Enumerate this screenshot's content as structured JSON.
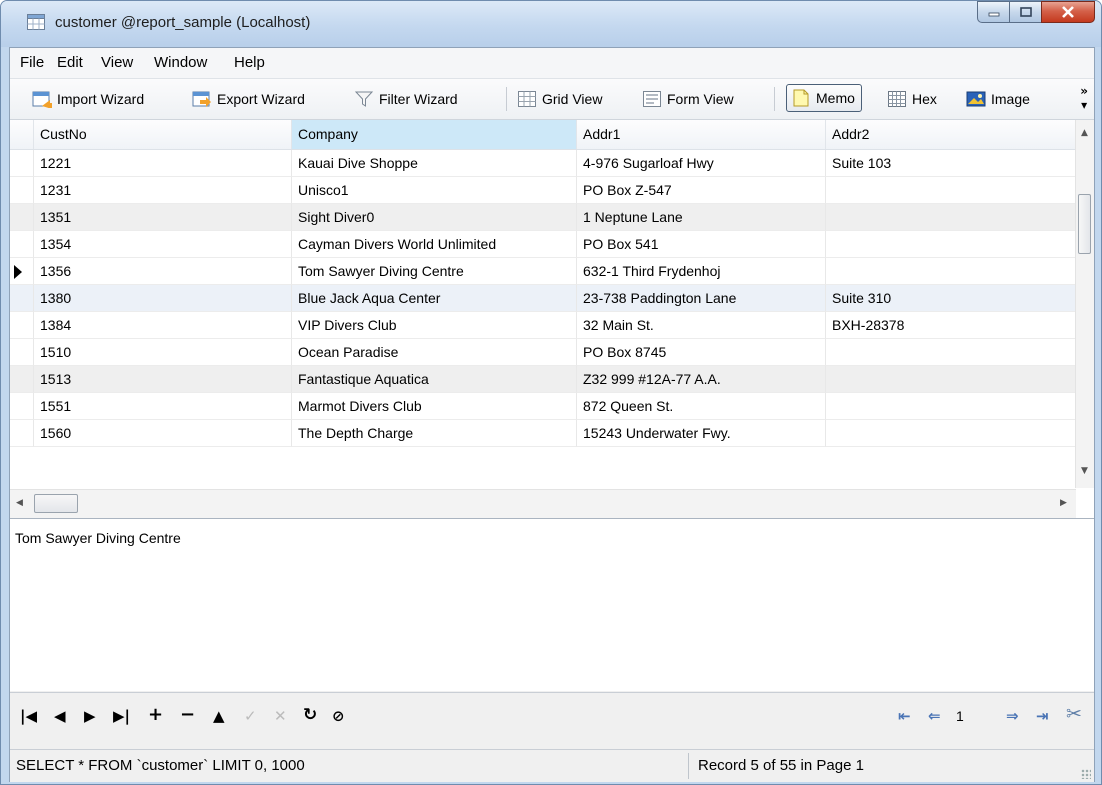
{
  "window": {
    "title": "customer @report_sample (Localhost)"
  },
  "menu": [
    "File",
    "Edit",
    "View",
    "Window",
    "Help"
  ],
  "toolbar": {
    "import_wizard": "Import Wizard",
    "export_wizard": "Export Wizard",
    "filter_wizard": "Filter Wizard",
    "grid_view": "Grid View",
    "form_view": "Form View",
    "memo": "Memo",
    "hex": "Hex",
    "image": "Image"
  },
  "grid": {
    "columns": [
      "CustNo",
      "Company",
      "Addr1",
      "Addr2"
    ],
    "rows": [
      [
        "1221",
        "Kauai Dive Shoppe",
        "4-976 Sugarloaf Hwy",
        "Suite 103"
      ],
      [
        "1231",
        "Unisco1",
        "PO Box Z-547",
        ""
      ],
      [
        "1351",
        "Sight Diver0",
        "1 Neptune Lane",
        ""
      ],
      [
        "1354",
        "Cayman Divers World Unlimited",
        "PO Box 541",
        ""
      ],
      [
        "1356",
        "Tom Sawyer Diving Centre",
        "632-1 Third Frydenhoj",
        ""
      ],
      [
        "1380",
        "Blue Jack Aqua Center",
        "23-738 Paddington Lane",
        "Suite 310"
      ],
      [
        "1384",
        "VIP Divers Club",
        "32 Main St.",
        "BXH-28378"
      ],
      [
        "1510",
        "Ocean Paradise",
        "PO Box 8745",
        ""
      ],
      [
        "1513",
        "Fantastique Aquatica",
        "Z32 999 #12A-77 A.A.",
        ""
      ],
      [
        "1551",
        "Marmot Divers Club",
        "872 Queen St.",
        ""
      ],
      [
        "1560",
        "The Depth Charge",
        "15243 Underwater Fwy.",
        ""
      ]
    ],
    "current_row_index": 4
  },
  "memo": {
    "text": "Tom Sawyer Diving Centre"
  },
  "navigator": {
    "page_value": "1"
  },
  "status": {
    "query": "SELECT * FROM `customer` LIMIT 0, 1000",
    "record_info": "Record 5 of 55 in Page 1"
  }
}
